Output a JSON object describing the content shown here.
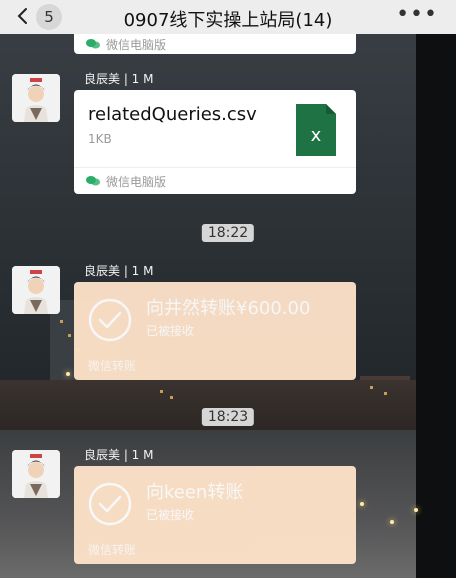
{
  "header": {
    "back_icon": "chevron-left-icon",
    "unread_count": "5",
    "title": "0907线下实操上站局(14)",
    "more_icon": "more-dots-icon"
  },
  "partial_file_footer": {
    "source": "微信电脑版"
  },
  "messages": [
    {
      "type": "file",
      "sender": "良辰美 | 1 M",
      "file_name": "relatedQueries.csv",
      "file_size": "1KB",
      "file_icon": "excel-file-icon",
      "source": "微信电脑版"
    },
    {
      "type": "timestamp",
      "time": "18:22"
    },
    {
      "type": "transfer",
      "sender": "良辰美 | 1 M",
      "amount_text": "向井然转账¥600.00",
      "status": "已被接收",
      "footer": "微信转账"
    },
    {
      "type": "timestamp",
      "time": "18:23"
    },
    {
      "type": "transfer",
      "sender": "良辰美 | 1 M",
      "amount_text": "向keen转账",
      "status": "已被接收",
      "footer": "微信转账"
    }
  ],
  "colors": {
    "header_bg": "#ededed",
    "transfer_bg": "#fde2c8",
    "file_bg": "#ffffff",
    "excel_green": "#1f7244"
  }
}
